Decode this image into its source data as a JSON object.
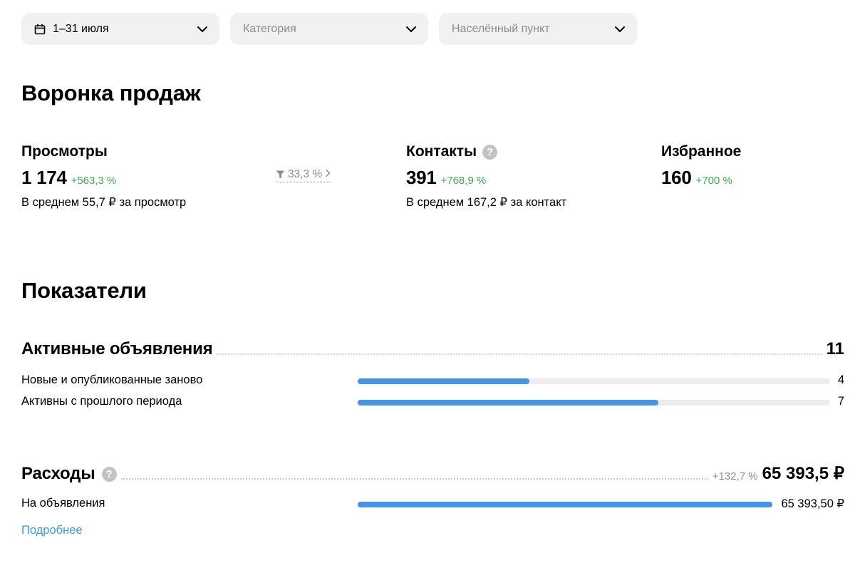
{
  "filters": {
    "period": {
      "label": "1–31 июля",
      "icon": "calendar-icon"
    },
    "category": {
      "placeholder": "Категория"
    },
    "location": {
      "placeholder": "Населённый пункт"
    }
  },
  "funnel": {
    "title": "Воронка продаж",
    "views": {
      "title": "Просмотры",
      "value": "1 174",
      "delta": "+563,3 %",
      "sub": "В среднем 55,7 ₽ за просмотр"
    },
    "conversion": {
      "value": "33,3 %",
      "icon": "funnel-icon"
    },
    "contacts": {
      "title": "Контакты",
      "value": "391",
      "delta": "+768,9 %",
      "sub": "В среднем 167,2 ₽ за контакт"
    },
    "favorites": {
      "title": "Избранное",
      "value": "160",
      "delta": "+700 %"
    }
  },
  "metrics": {
    "title": "Показатели",
    "active_ads": {
      "title": "Активные объявления",
      "value": "11",
      "rows": [
        {
          "label": "Новые и опубликованные заново",
          "value": "4",
          "fraction": 0.364
        },
        {
          "label": "Активны с прошлого периода",
          "value": "7",
          "fraction": 0.636
        }
      ]
    },
    "expenses": {
      "title": "Расходы",
      "delta": "+132,7 %",
      "value": "65 393,5 ₽",
      "rows": [
        {
          "label": "На объявления",
          "value": "65 393,50 ₽",
          "fraction": 1.0
        }
      ]
    },
    "more_link": "Подробнее"
  },
  "colors": {
    "accent_blue": "#4494ea",
    "link": "#3f97e8",
    "positive": "#3fa94f",
    "muted": "#8c8c8c",
    "filter_bg": "#f2f1f0"
  }
}
